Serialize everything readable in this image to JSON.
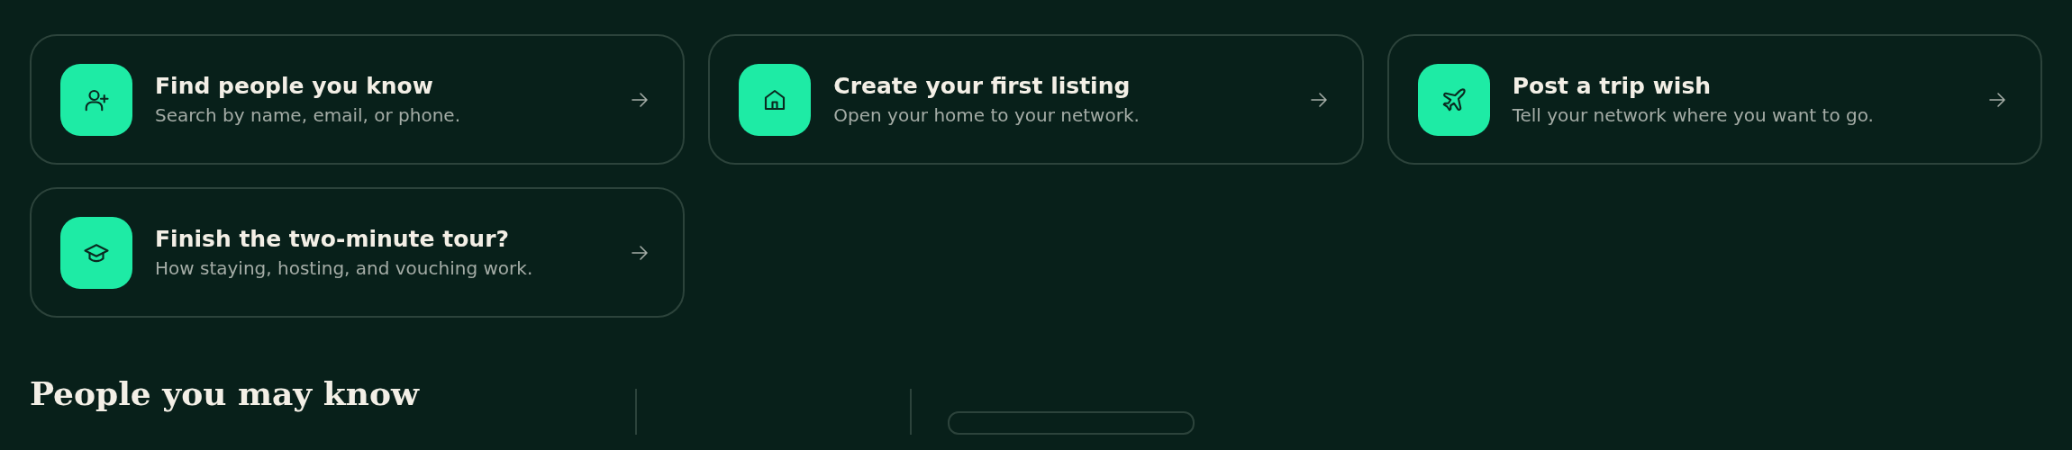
{
  "actions": [
    {
      "title": "Find people you know",
      "subtitle": "Search by name, email, or phone."
    },
    {
      "title": "Create your first listing",
      "subtitle": "Open your home to your network."
    },
    {
      "title": "Post a trip wish",
      "subtitle": "Tell your network where you want to go."
    },
    {
      "title": "Finish the two-minute tour?",
      "subtitle": "How staying, hosting, and vouching work."
    }
  ],
  "section": {
    "title": "People you may know"
  }
}
